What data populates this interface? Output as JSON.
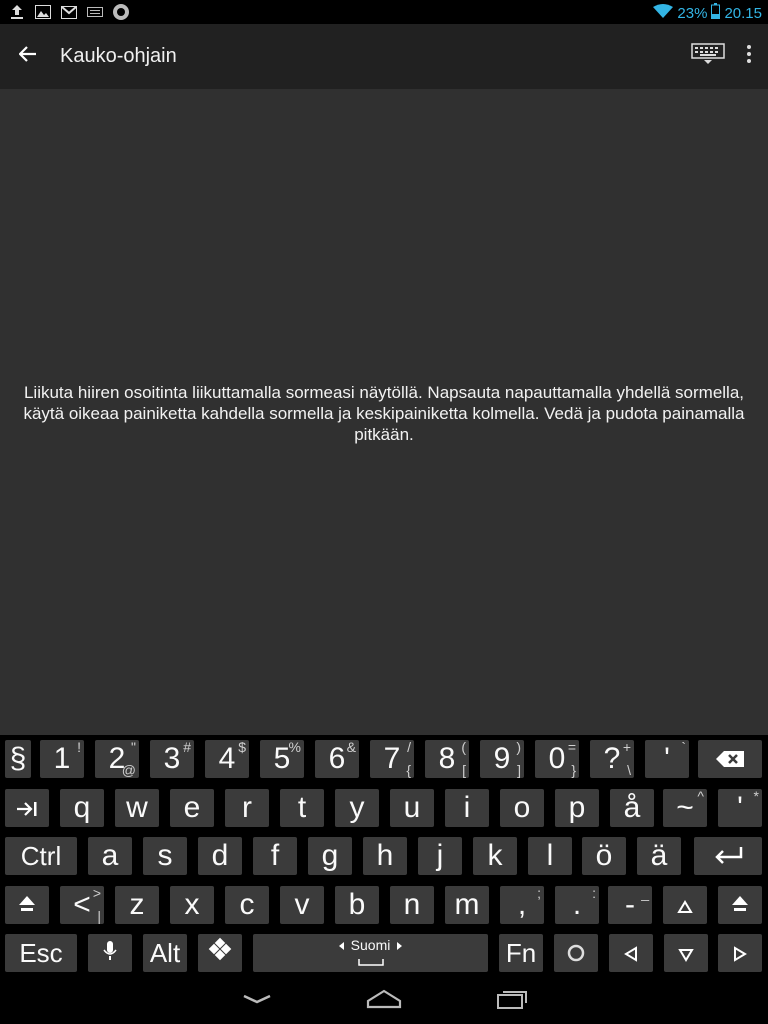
{
  "statusbar": {
    "left_icons": [
      "upload-icon",
      "image-icon",
      "gmail-icon",
      "keyboard-icon",
      "remote-app-icon"
    ],
    "battery_percent": "23%",
    "time": "20.15",
    "accent": "#33b5e5"
  },
  "appbar": {
    "title": "Kauko-ohjain",
    "back_icon": "arrow-left-icon",
    "keyboard_icon": "keyboard-icon",
    "more_icon": "overflow-menu-icon"
  },
  "instructions": "Liikuta hiiren osoitinta liikuttamalla sormeasi näytöllä. Napsauta napauttamalla yhdellä sormella, käytä oikeaa painiketta kahdella sormella ja keskipainiketta kolmella. Vedä ja pudota painamalla pitkään.",
  "keyboard": {
    "row1": [
      {
        "main": "§",
        "alt": ""
      },
      {
        "main": "1",
        "alt": "!"
      },
      {
        "main": "2",
        "alt": "\"",
        "alt2": "@"
      },
      {
        "main": "3",
        "alt": "#"
      },
      {
        "main": "4",
        "alt": "$"
      },
      {
        "main": "5",
        "alt": "%"
      },
      {
        "main": "6",
        "alt": "&"
      },
      {
        "main": "7",
        "alt": "/",
        "alt2": "{"
      },
      {
        "main": "8",
        "alt": "(",
        "alt2": "["
      },
      {
        "main": "9",
        "alt": ")",
        "alt2": "]"
      },
      {
        "main": "0",
        "alt": "=",
        "alt2": "}"
      },
      {
        "main": "?",
        "alt": "+",
        "alt2": "\\"
      },
      {
        "main": "'",
        "alt": "`"
      }
    ],
    "row2": [
      "q",
      "w",
      "e",
      "r",
      "t",
      "y",
      "u",
      "i",
      "o",
      "p",
      "å"
    ],
    "row2_tilde": {
      "main": "~",
      "alt": "^"
    },
    "row2_last": {
      "main": "'",
      "alt": "*"
    },
    "ctrl_label": "Ctrl",
    "row3": [
      "a",
      "s",
      "d",
      "f",
      "g",
      "h",
      "j",
      "k",
      "l",
      "ö",
      "ä"
    ],
    "row4_lt": {
      "main": "<",
      "alt": ">",
      "alt2": "|"
    },
    "row4": [
      "z",
      "x",
      "c",
      "v",
      "b",
      "n",
      "m"
    ],
    "row4_comma": {
      "main": ",",
      "alt": ";"
    },
    "row4_dot": {
      "main": ".",
      "alt": ":"
    },
    "row4_dash": {
      "main": "-",
      "alt": "_"
    },
    "esc_label": "Esc",
    "alt_label": "Alt",
    "space_label": "Suomi",
    "fn_label": "Fn"
  },
  "navbar": {
    "back_icon": "nav-back-icon",
    "home_icon": "nav-home-icon",
    "recents_icon": "nav-recents-icon"
  }
}
